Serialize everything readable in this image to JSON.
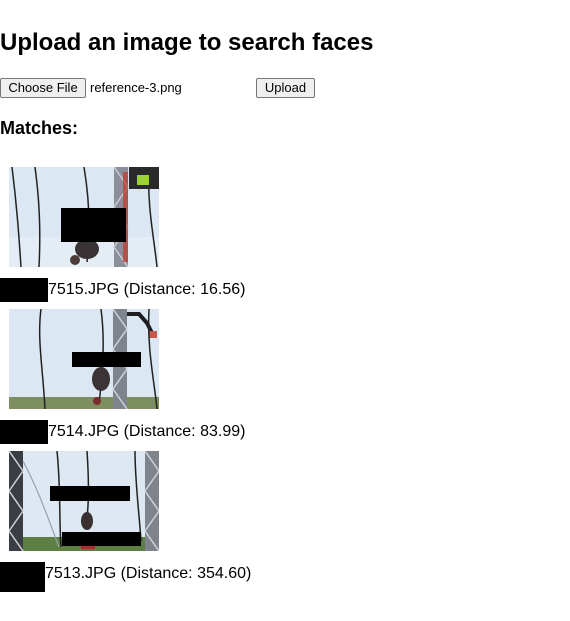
{
  "page": {
    "heading": "Upload an image to search faces",
    "choose_file_label": "Choose File",
    "selected_file": "reference-3.png",
    "upload_label": "Upload",
    "matches_heading": "Matches:"
  },
  "matches": [
    {
      "caption": "7515.JPG (Distance: 16.56)"
    },
    {
      "caption": "7514.JPG (Distance: 83.99)"
    },
    {
      "caption": "7513.JPG (Distance: 354.60)"
    }
  ],
  "colors": {
    "button_bg": "#efefef",
    "button_border": "#767676",
    "redaction": "#000000",
    "sky": "#d9e6f2",
    "grass": "#5f7d4a"
  }
}
